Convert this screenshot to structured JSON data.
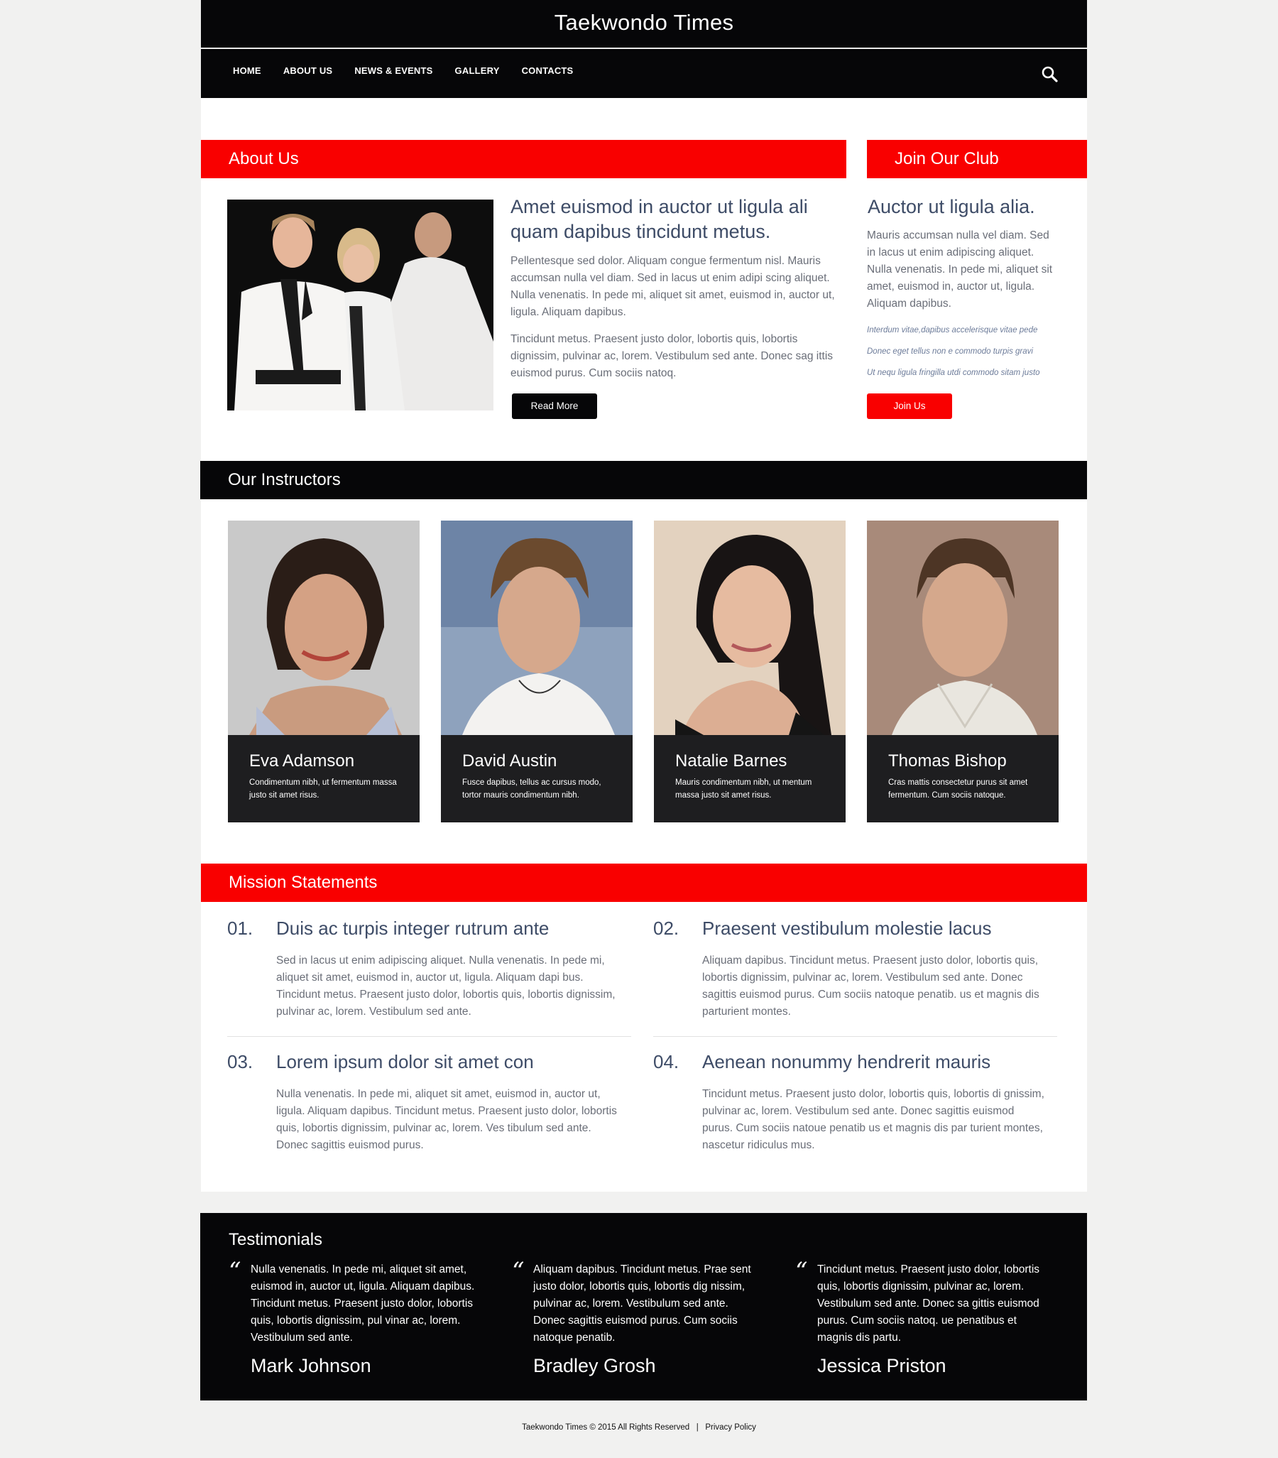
{
  "header": {
    "site_title": "Taekwondo Times",
    "nav": [
      "HOME",
      "ABOUT US",
      "NEWS & EVENTS",
      "GALLERY",
      "CONTACTS"
    ],
    "search_icon": "search-icon"
  },
  "about": {
    "title": "About Us",
    "heading": "Amet euismod in auctor ut ligula ali quam dapibus tincidunt metus.",
    "para1": "Pellentesque sed dolor. Aliquam congue fermentum nisl. Mauris accumsan nulla vel diam. Sed in lacus ut enim adipi scing aliquet. Nulla venenatis. In pede mi, aliquet sit amet, euismod in, auctor ut, ligula. Aliquam dapibus.",
    "para2": "Tincidunt metus. Praesent justo dolor, lobortis quis, lobortis dignissim, pulvinar ac, lorem. Vestibulum sed ante. Donec sag ittis euismod purus. Cum sociis natoq.",
    "button": "Read More"
  },
  "join": {
    "title": "Join Our Club",
    "heading": "Auctor ut ligula alia.",
    "text": "Mauris accumsan nulla vel diam. Sed in lacus ut enim adipiscing aliquet. Nulla venenatis. In pede mi, aliquet sit amet, euismod in, auctor ut, ligula. Aliquam dapibus.",
    "lines": [
      "Interdum vitae,dapibus accelerisque vitae pede",
      "Donec eget tellus non e commodo turpis gravi",
      "Ut nequ ligula fringilla utdi commodo sitam justo"
    ],
    "button": "Join Us"
  },
  "instructors": {
    "title": "Our Instructors",
    "items": [
      {
        "name": "Eva Adamson",
        "desc": "Condimentum nibh, ut fermentum massa justo sit amet risus."
      },
      {
        "name": "David Austin",
        "desc": "Fusce dapibus, tellus ac cursus modo, tortor mauris condimentum nibh."
      },
      {
        "name": "Natalie Barnes",
        "desc": "Mauris condimentum nibh, ut mentum massa justo sit amet risus."
      },
      {
        "name": "Thomas Bishop",
        "desc": "Cras mattis consectetur purus sit amet fermentum. Cum sociis natoque."
      }
    ]
  },
  "mission": {
    "title": "Mission Statements",
    "items": [
      {
        "num": "01.",
        "title": "Duis ac turpis integer rutrum ante",
        "text": "Sed in lacus ut enim adipiscing aliquet. Nulla venenatis. In pede mi, aliquet sit amet, euismod in, auctor ut, ligula. Aliquam dapi bus. Tincidunt metus. Praesent justo dolor, lobortis quis, lobortis dignissim, pulvinar ac, lorem. Vestibulum sed ante."
      },
      {
        "num": "02.",
        "title": "Praesent vestibulum molestie lacus",
        "text": "Aliquam dapibus. Tincidunt metus. Praesent justo dolor, lobortis quis, lobortis dignissim, pulvinar ac, lorem. Vestibulum sed ante. Donec sagittis euismod purus. Cum sociis natoque penatib. us et magnis dis parturient montes."
      },
      {
        "num": "03.",
        "title": "Lorem ipsum dolor sit amet con",
        "text": "Nulla venenatis. In pede mi, aliquet sit amet, euismod in, auctor ut, ligula. Aliquam dapibus. Tincidunt metus. Praesent justo dolor, lobortis quis, lobortis dignissim, pulvinar ac, lorem. Ves tibulum sed ante. Donec sagittis euismod purus."
      },
      {
        "num": "04.",
        "title": "Aenean nonummy hendrerit mauris",
        "text": "Tincidunt metus. Praesent justo dolor, lobortis quis, lobortis di gnissim, pulvinar ac, lorem. Vestibulum sed ante. Donec sagittis euismod purus. Cum sociis natoue penatib us et magnis dis par turient montes, nascetur ridiculus mus."
      }
    ]
  },
  "testimonials": {
    "title": "Testimonials",
    "items": [
      {
        "text": "Nulla venenatis. In pede mi, aliquet sit amet, euismod in, auctor ut, ligula. Aliquam dapibus. Tincidunt metus. Praesent justo dolor, lobortis quis, lobortis dignissim, pul vinar ac, lorem. Vestibulum sed ante.",
        "name": "Mark Johnson"
      },
      {
        "text": "Aliquam dapibus. Tincidunt metus. Prae sent justo dolor, lobortis quis, lobortis dig nissim, pulvinar ac, lorem. Vestibulum sed ante. Donec sagittis euismod purus. Cum sociis natoque penatib.",
        "name": "Bradley Grosh"
      },
      {
        "text": "Tincidunt metus. Praesent justo dolor, lobortis quis, lobortis dignissim, pulvinar ac, lorem. Vestibulum sed ante. Donec sa gittis euismod purus. Cum sociis natoq. ue penatibus et magnis dis partu.",
        "name": "Jessica Priston"
      }
    ]
  },
  "footer": {
    "copyright": "Taekwondo Times © 2015 All Rights Reserved",
    "separator": "|",
    "privacy": "Privacy Policy"
  },
  "colors": {
    "accent_red": "#f90000",
    "header_black": "#060608",
    "card_dark": "#1e1e20",
    "heading_blue": "#3e4c67"
  }
}
